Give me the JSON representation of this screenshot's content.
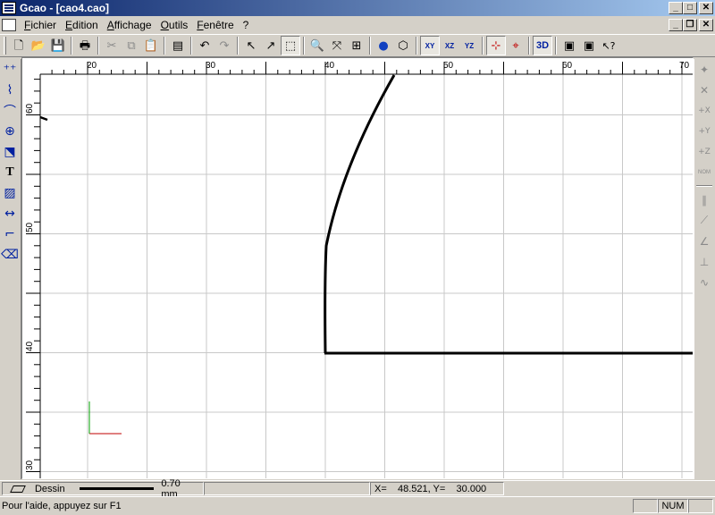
{
  "window": {
    "title": "Gcao - [cao4.cao]",
    "caption_buttons": [
      "_",
      "□",
      "✕"
    ]
  },
  "menubar": {
    "items": [
      "Fichier",
      "Edition",
      "Affichage",
      "Outils",
      "Fenêtre",
      "?"
    ],
    "mdi_buttons": [
      "_",
      "❐",
      "✕"
    ]
  },
  "toolbar": {
    "buttons": [
      {
        "name": "new-file-icon",
        "glyph": "🗋"
      },
      {
        "name": "open-folder-icon",
        "glyph": "📂"
      },
      {
        "name": "save-icon",
        "glyph": "💾"
      },
      {
        "name": "print-icon",
        "glyph": "🖶"
      },
      {
        "name": "cut-icon",
        "glyph": "✂"
      },
      {
        "name": "copy-icon",
        "glyph": "⧉"
      },
      {
        "name": "paste-icon",
        "glyph": "📋"
      },
      {
        "name": "properties-icon",
        "glyph": "▤"
      },
      {
        "name": "undo-icon",
        "glyph": "↶"
      },
      {
        "name": "redo-icon",
        "glyph": "↷"
      },
      {
        "name": "select-arrow-icon",
        "glyph": "↖"
      },
      {
        "name": "select-curve-icon",
        "glyph": "↗"
      },
      {
        "name": "zoom-window-icon",
        "glyph": "⬚"
      },
      {
        "name": "zoom-icon",
        "glyph": "🔍"
      },
      {
        "name": "zoom-pan-icon",
        "glyph": "⤧"
      },
      {
        "name": "zoom-extents-icon",
        "glyph": "⊞"
      },
      {
        "name": "render-sphere-icon",
        "glyph": "●"
      },
      {
        "name": "box-3d-icon",
        "glyph": "⬡"
      },
      {
        "name": "view-xy-icon",
        "glyph": "XY"
      },
      {
        "name": "view-xz-icon",
        "glyph": "XZ"
      },
      {
        "name": "view-yz-icon",
        "glyph": "YZ"
      },
      {
        "name": "snap-grid-icon",
        "glyph": "⊹"
      },
      {
        "name": "snap-point-icon",
        "glyph": "⌖"
      },
      {
        "name": "view-3d-icon",
        "glyph": "3D"
      },
      {
        "name": "window-2d-icon",
        "glyph": "▣"
      },
      {
        "name": "window-3d-icon",
        "glyph": "▣"
      },
      {
        "name": "help-pointer-icon",
        "glyph": "↖?"
      }
    ]
  },
  "left_tools": [
    {
      "name": "point-tool-icon",
      "glyph": "⁺⁺"
    },
    {
      "name": "polyline-tool-icon",
      "glyph": "⌇"
    },
    {
      "name": "curve-tool-icon",
      "glyph": "⌒"
    },
    {
      "name": "circle-tool-icon",
      "glyph": "⊕"
    },
    {
      "name": "transform-tool-icon",
      "glyph": "⬔"
    },
    {
      "name": "text-tool-icon",
      "glyph": "T"
    },
    {
      "name": "hatch-tool-icon",
      "glyph": "▨"
    },
    {
      "name": "dimension-tool-icon",
      "glyph": "↔"
    },
    {
      "name": "fillet-tool-icon",
      "glyph": "⌐"
    },
    {
      "name": "eraser-tool-icon",
      "glyph": "⌫"
    }
  ],
  "right_tools": [
    {
      "name": "snap-end-icon",
      "glyph": "✦"
    },
    {
      "name": "snap-intersection-icon",
      "glyph": "✕"
    },
    {
      "name": "add-x-icon",
      "glyph": "+X"
    },
    {
      "name": "add-y-icon",
      "glyph": "+Y"
    },
    {
      "name": "add-z-icon",
      "glyph": "+Z"
    },
    {
      "name": "snap-nom-icon",
      "glyph": "NOM"
    },
    {
      "name": "parallel-icon",
      "glyph": "∥"
    },
    {
      "name": "tangent-icon",
      "glyph": "⟋"
    },
    {
      "name": "angle-icon",
      "glyph": "∠"
    },
    {
      "name": "perpendicular-icon",
      "glyph": "⊥"
    },
    {
      "name": "curve-snap-icon",
      "glyph": "∿"
    }
  ],
  "rulers": {
    "x_labels": [
      "20",
      "30",
      "40",
      "50",
      "60",
      "70"
    ],
    "y_labels": [
      "60",
      "50",
      "40",
      "30"
    ]
  },
  "properties": {
    "layer": "Dessin",
    "line_width": "0.70 mm",
    "coordinates": "X=    48.521, Y=    30.000"
  },
  "status": {
    "help_text": "Pour l'aide, appuyez sur F1",
    "num": "NUM"
  },
  "colors": {
    "axis_x": "#c00000",
    "axis_y": "#00a000",
    "grid": "#c8c8c8",
    "geometry": "#000000",
    "title_start": "#0a246a",
    "title_end": "#a6caf0"
  }
}
